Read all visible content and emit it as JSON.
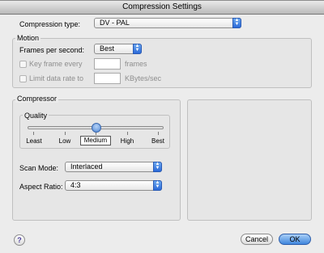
{
  "window": {
    "title": "Compression Settings"
  },
  "compression": {
    "label": "Compression type:",
    "value": "DV - PAL"
  },
  "motion": {
    "group_label": "Motion",
    "fps_label": "Frames per second:",
    "fps_value": "Best",
    "keyframe_label": "Key frame every",
    "keyframe_value": "",
    "keyframe_unit": "frames",
    "limit_label": "Limit data rate to",
    "limit_value": "",
    "limit_unit": "KBytes/sec"
  },
  "compressor": {
    "group_label": "Compressor",
    "quality_label": "Quality",
    "quality_levels": [
      "Least",
      "Low",
      "Medium",
      "High",
      "Best"
    ],
    "quality_selected": "Medium",
    "scan_label": "Scan Mode:",
    "scan_value": "Interlaced",
    "aspect_label": "Aspect Ratio:",
    "aspect_value": "4:3"
  },
  "buttons": {
    "cancel": "Cancel",
    "ok": "OK",
    "help_glyph": "?"
  },
  "icons": {
    "popup_arrow": "updown-arrow-icon",
    "help": "help-icon"
  },
  "colors": {
    "accent": "#3f86dd",
    "dialog_bg": "#ececec"
  }
}
